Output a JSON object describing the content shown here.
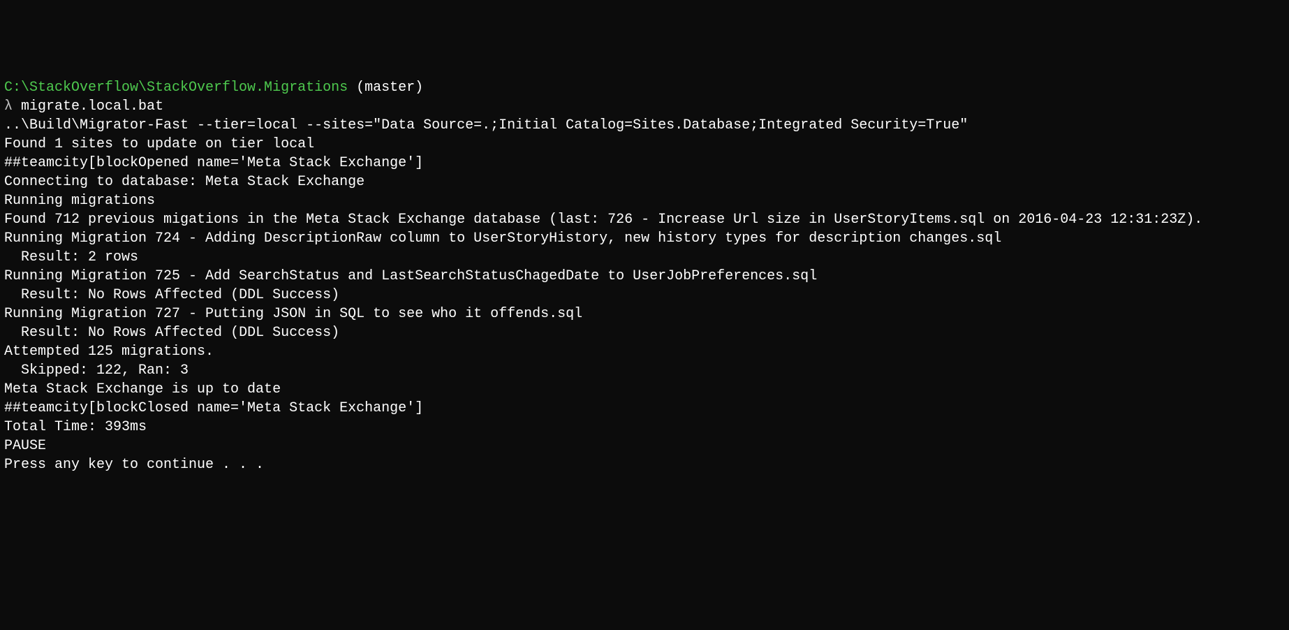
{
  "prompt": {
    "path": "C:\\StackOverflow\\StackOverflow.Migrations",
    "branch": "(master)",
    "symbol": "λ",
    "command": "migrate.local.bat"
  },
  "output": {
    "blank1": "",
    "line1": "..\\Build\\Migrator-Fast --tier=local --sites=\"Data Source=.;Initial Catalog=Sites.Database;Integrated Security=True\"",
    "line2": "Found 1 sites to update on tier local",
    "line3": "##teamcity[blockOpened name='Meta Stack Exchange']",
    "line4": "Connecting to database: Meta Stack Exchange",
    "line5": "Running migrations",
    "line6": "Found 712 previous migations in the Meta Stack Exchange database (last: 726 - Increase Url size in UserStoryItems.sql on 2016-04-23 12:31:23Z).",
    "line7": "Running Migration 724 - Adding DescriptionRaw column to UserStoryHistory, new history types for description changes.sql",
    "line8": "  Result: 2 rows",
    "blank2": "",
    "line9": "Running Migration 725 - Add SearchStatus and LastSearchStatusChagedDate to UserJobPreferences.sql",
    "line10": "  Result: No Rows Affected (DDL Success)",
    "blank3": "",
    "line11": "Running Migration 727 - Putting JSON in SQL to see who it offends.sql",
    "line12": "  Result: No Rows Affected (DDL Success)",
    "blank4": "",
    "line13": "Attempted 125 migrations.",
    "line14": "  Skipped: 122, Ran: 3",
    "line15": "Meta Stack Exchange is up to date",
    "line16": "##teamcity[blockClosed name='Meta Stack Exchange']",
    "blank5": "",
    "line17": "Total Time: 393ms",
    "blank6": "",
    "line18": "PAUSE",
    "line19": "Press any key to continue . . ."
  }
}
